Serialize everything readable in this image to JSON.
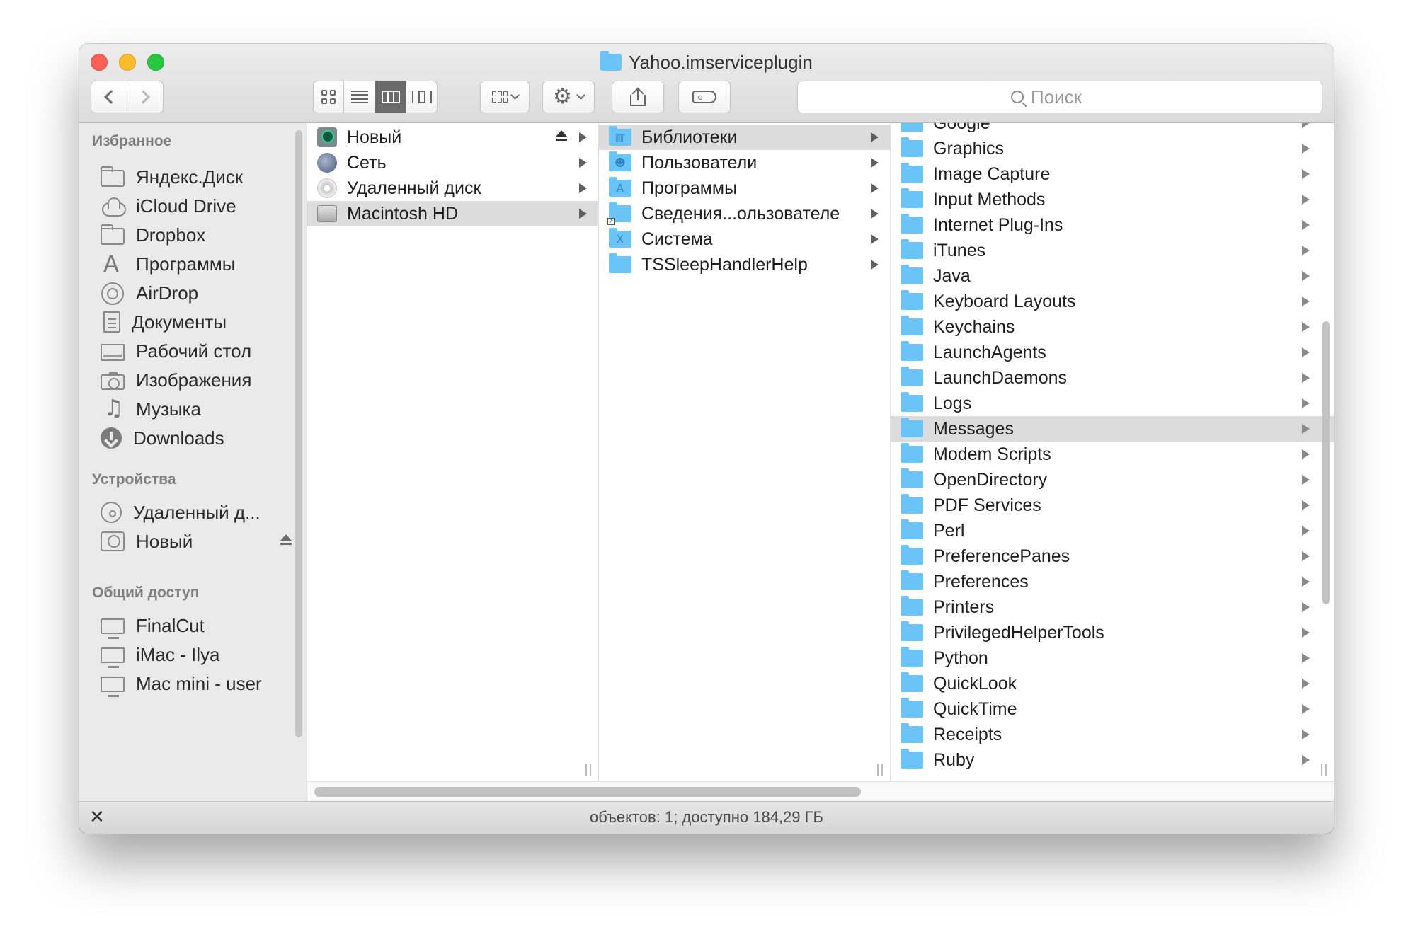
{
  "window": {
    "title": "Yahoo.imserviceplugin"
  },
  "toolbar": {
    "search_placeholder": "Поиск",
    "view_modes": [
      "icons",
      "list",
      "columns",
      "cover-flow"
    ],
    "active_view": "columns"
  },
  "sidebar": {
    "favorites_heading": "Избранное",
    "favorites": [
      {
        "label": "Яндекс.Диск",
        "icon": "folder-icon"
      },
      {
        "label": "iCloud Drive",
        "icon": "cloud-icon"
      },
      {
        "label": "Dropbox",
        "icon": "folder-icon"
      },
      {
        "label": "Программы",
        "icon": "applications-icon"
      },
      {
        "label": "AirDrop",
        "icon": "airdrop-icon"
      },
      {
        "label": "Документы",
        "icon": "documents-icon"
      },
      {
        "label": "Рабочий стол",
        "icon": "desktop-icon"
      },
      {
        "label": "Изображения",
        "icon": "camera-icon"
      },
      {
        "label": "Музыка",
        "icon": "music-icon"
      },
      {
        "label": "Downloads",
        "icon": "downloads-icon"
      }
    ],
    "devices_heading": "Устройства",
    "devices": [
      {
        "label": "Удаленный д...",
        "icon": "disc-icon"
      },
      {
        "label": "Новый",
        "icon": "time-machine-icon",
        "ejectable": true
      }
    ],
    "shared_heading": "Общий доступ",
    "shared": [
      {
        "label": "FinalCut",
        "icon": "monitor-icon"
      },
      {
        "label": "iMac - Ilya",
        "icon": "monitor-icon"
      },
      {
        "label": "Mac mini - user",
        "icon": "monitor-icon"
      }
    ]
  },
  "columns": {
    "col1": [
      {
        "name": "Новый",
        "icon": "time-machine-volume-icon",
        "ejectable": true
      },
      {
        "name": "Сеть",
        "icon": "network-icon"
      },
      {
        "name": "Удаленный диск",
        "icon": "remote-disc-icon"
      },
      {
        "name": "Macintosh HD",
        "icon": "hard-drive-icon",
        "selected": true
      }
    ],
    "col2": [
      {
        "name": "Библиотеки",
        "icon": "library-folder-icon",
        "selected": true
      },
      {
        "name": "Пользователи",
        "icon": "users-folder-icon"
      },
      {
        "name": "Программы",
        "icon": "applications-folder-icon"
      },
      {
        "name": "Сведения...ользователе",
        "icon": "alias-folder-icon"
      },
      {
        "name": "Система",
        "icon": "system-folder-icon"
      },
      {
        "name": "TSSleepHandlerHelp",
        "icon": "folder-icon"
      }
    ],
    "col3": [
      {
        "name": "Google"
      },
      {
        "name": "Graphics"
      },
      {
        "name": "Image Capture"
      },
      {
        "name": "Input Methods"
      },
      {
        "name": "Internet Plug-Ins"
      },
      {
        "name": "iTunes"
      },
      {
        "name": "Java"
      },
      {
        "name": "Keyboard Layouts"
      },
      {
        "name": "Keychains"
      },
      {
        "name": "LaunchAgents"
      },
      {
        "name": "LaunchDaemons"
      },
      {
        "name": "Logs"
      },
      {
        "name": "Messages",
        "selected": true
      },
      {
        "name": "Modem Scripts"
      },
      {
        "name": "OpenDirectory"
      },
      {
        "name": "PDF Services"
      },
      {
        "name": "Perl"
      },
      {
        "name": "PreferencePanes"
      },
      {
        "name": "Preferences"
      },
      {
        "name": "Printers"
      },
      {
        "name": "PrivilegedHelperTools"
      },
      {
        "name": "Python"
      },
      {
        "name": "QuickLook"
      },
      {
        "name": "QuickTime"
      },
      {
        "name": "Receipts"
      },
      {
        "name": "Ruby"
      }
    ]
  },
  "status": {
    "text": "объектов: 1; доступно 184,29 ГБ"
  },
  "colors": {
    "folder": "#6cc3f5",
    "selection": "#dcdcdc",
    "sidebar": "#eaeaea"
  }
}
